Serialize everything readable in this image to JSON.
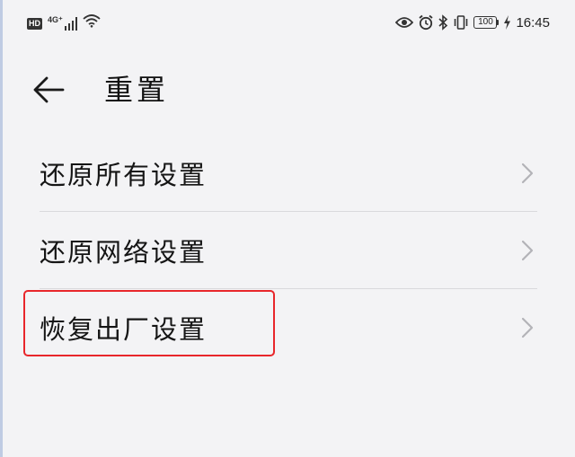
{
  "status_bar": {
    "hd_badge": "HD",
    "network": "4G⁺",
    "battery": "100",
    "time": "16:45",
    "icons": [
      "eye-icon",
      "alarm-icon",
      "bluetooth-icon",
      "vibrate-icon",
      "charging-icon",
      "signal-icon",
      "wifi-icon"
    ]
  },
  "header": {
    "back_icon": "back-arrow-icon",
    "title": "重置"
  },
  "items": [
    {
      "label": "还原所有设置",
      "icon": "chevron-right-icon"
    },
    {
      "label": "还原网络设置",
      "icon": "chevron-right-icon"
    },
    {
      "label": "恢复出厂设置",
      "icon": "chevron-right-icon"
    }
  ],
  "colors": {
    "background": "#f3f3f5",
    "highlight": "#e8262b",
    "divider": "#d9d9dc",
    "chevron": "#b3b3b8"
  }
}
